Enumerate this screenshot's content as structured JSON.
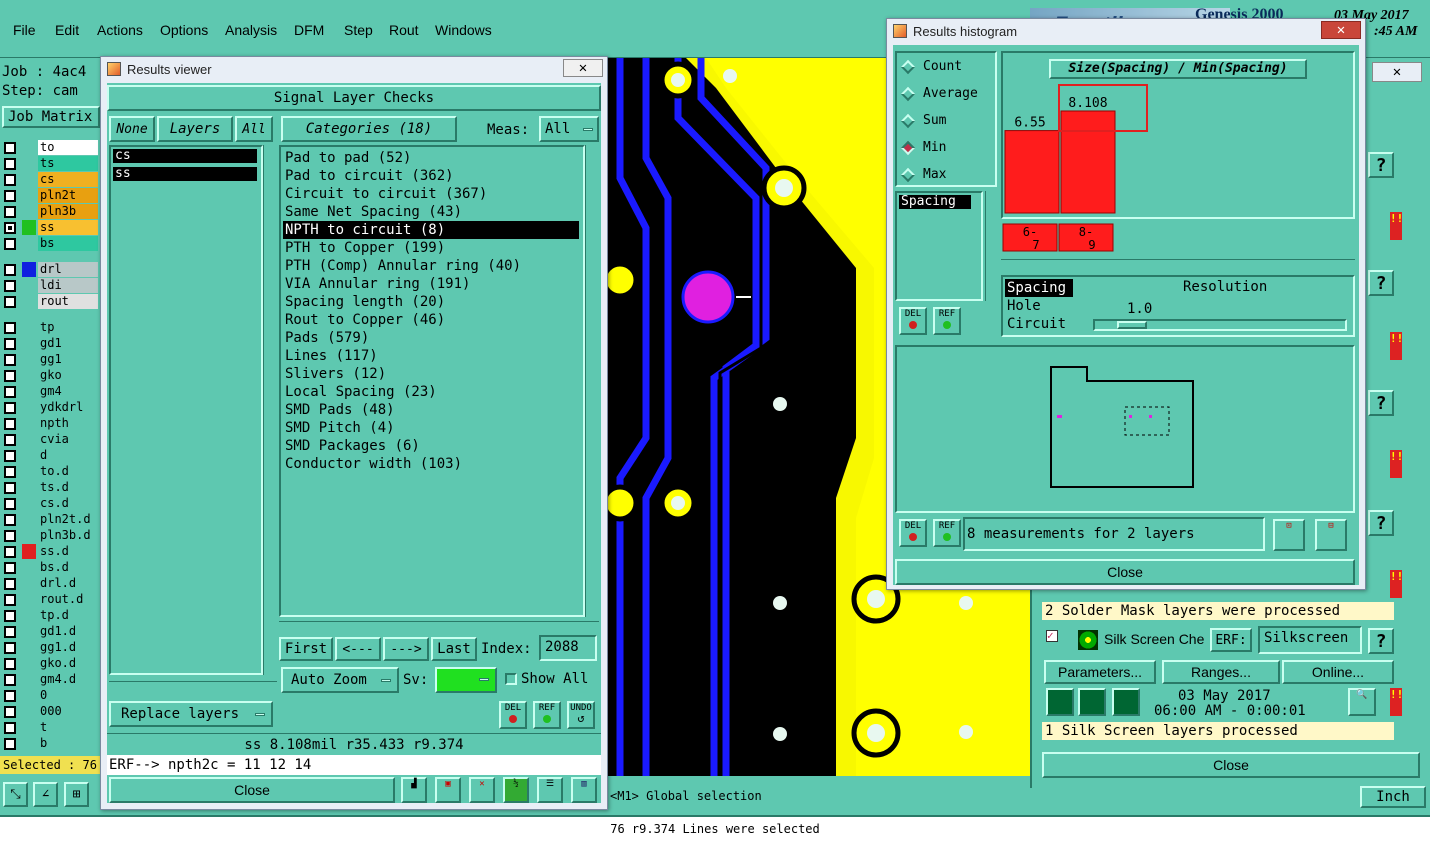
{
  "menubar": {
    "items": [
      "File",
      "Edit",
      "Actions",
      "Options",
      "Analysis",
      "DFM",
      "Step",
      "Rout",
      "Windows"
    ],
    "job_label": "Job : 4ac4",
    "step_label": "Step: cam",
    "job_matrix": "Job Matrix",
    "banner_date": "03 May 2017",
    "banner_time": ":45 AM",
    "banner_logo": "Frontline",
    "banner_app": "Genesis 2000"
  },
  "layers": [
    {
      "name": "to",
      "color": "#ffffff",
      "checked": false
    },
    {
      "name": "ts",
      "color": "#2ec8a0",
      "checked": false
    },
    {
      "name": "cs",
      "color": "#f0b020",
      "checked": false
    },
    {
      "name": "pln2t",
      "color": "#e8a010",
      "checked": false
    },
    {
      "name": "pln3b",
      "color": "#e8a010",
      "checked": false
    },
    {
      "name": "ss",
      "color": "#f8c030",
      "checked": true,
      "active": true
    },
    {
      "name": "bs",
      "color": "#2ec8a0",
      "checked": false
    },
    {
      "name": "drl",
      "color": "#b8c8c8",
      "checked": false,
      "swatch": "#1020e0"
    },
    {
      "name": "ldi",
      "color": "#b8c8c8",
      "checked": false
    },
    {
      "name": "rout",
      "color": "#e0e0e0",
      "checked": false
    },
    {
      "name": "tp",
      "color": "#5ec8b0",
      "checked": false
    },
    {
      "name": "gd1",
      "color": "#5ec8b0",
      "checked": false
    },
    {
      "name": "gg1",
      "color": "#5ec8b0",
      "checked": false
    },
    {
      "name": "gko",
      "color": "#5ec8b0",
      "checked": false
    },
    {
      "name": "gm4",
      "color": "#5ec8b0",
      "checked": false
    },
    {
      "name": "ydkdrl",
      "color": "#5ec8b0",
      "checked": false
    },
    {
      "name": "npth",
      "color": "#5ec8b0",
      "checked": false
    },
    {
      "name": "cvia",
      "color": "#5ec8b0",
      "checked": false
    },
    {
      "name": "d",
      "color": "#5ec8b0",
      "checked": false
    },
    {
      "name": "to.d",
      "color": "#5ec8b0",
      "checked": false
    },
    {
      "name": "ts.d",
      "color": "#5ec8b0",
      "checked": false
    },
    {
      "name": "cs.d",
      "color": "#5ec8b0",
      "checked": false
    },
    {
      "name": "pln2t.d",
      "color": "#5ec8b0",
      "checked": false
    },
    {
      "name": "pln3b.d",
      "color": "#5ec8b0",
      "checked": false
    },
    {
      "name": "ss.d",
      "color": "#5ec8b0",
      "checked": false,
      "swatch": "#e02020"
    },
    {
      "name": "bs.d",
      "color": "#5ec8b0",
      "checked": false
    },
    {
      "name": "drl.d",
      "color": "#5ec8b0",
      "checked": false
    },
    {
      "name": "rout.d",
      "color": "#5ec8b0",
      "checked": false
    },
    {
      "name": "tp.d",
      "color": "#5ec8b0",
      "checked": false
    },
    {
      "name": "gd1.d",
      "color": "#5ec8b0",
      "checked": false
    },
    {
      "name": "gg1.d",
      "color": "#5ec8b0",
      "checked": false
    },
    {
      "name": "gko.d",
      "color": "#5ec8b0",
      "checked": false
    },
    {
      "name": "gm4.d",
      "color": "#5ec8b0",
      "checked": false
    },
    {
      "name": "0",
      "color": "#5ec8b0",
      "checked": false
    },
    {
      "name": "000",
      "color": "#5ec8b0",
      "checked": false
    },
    {
      "name": "t",
      "color": "#5ec8b0",
      "checked": false
    },
    {
      "name": "b",
      "color": "#5ec8b0",
      "checked": false
    }
  ],
  "selected_label": "Selected : 76",
  "results_viewer": {
    "title": "Results viewer",
    "close_x": "✕",
    "section_title": "Signal Layer Checks",
    "btn_none": "None",
    "btn_layers": "Layers",
    "btn_all": "All",
    "categories_btn": "Categories (18)",
    "meas_label": "Meas:",
    "meas_value": "All",
    "layer_list": [
      "cs",
      "ss"
    ],
    "categories": [
      "Pad to pad (52)",
      "Pad to circuit (362)",
      "Circuit to circuit (367)",
      "Same Net Spacing (43)",
      "NPTH to circuit (8)",
      "PTH to Copper (199)",
      "PTH (Comp) Annular ring (40)",
      "VIA Annular ring (191)",
      "Spacing length (20)",
      "Rout to Copper (46)",
      "Pads (579)",
      "Lines (117)",
      "Slivers (12)",
      "Local Spacing (23)",
      "SMD Pads (48)",
      "SMD Pitch (4)",
      "SMD Packages (6)",
      "Conductor width (103)"
    ],
    "selected_category_index": 4,
    "nav_first": "First",
    "nav_prev": "<---",
    "nav_next": "--->",
    "nav_last": "Last",
    "index_label": "Index:",
    "index_value": "2088",
    "auto_zoom": "Auto Zoom",
    "sv_label": "Sv:",
    "show_all": "Show All",
    "replace_layers": "Replace layers",
    "btn_del": "DEL",
    "btn_ref": "REF",
    "btn_undo": "UNDO",
    "status_measure": "ss 8.108mil  r35.433  r9.374",
    "erf_line": "ERF--> npth2c = 11 12 14",
    "close": "Close"
  },
  "histogram": {
    "title": "Results histogram",
    "close_x": "✕",
    "radios": [
      {
        "label": "Count",
        "on": false
      },
      {
        "label": "Average",
        "on": false
      },
      {
        "label": "Sum",
        "on": false
      },
      {
        "label": "Min",
        "on": true
      },
      {
        "label": "Max",
        "on": false
      }
    ],
    "spacing_item": "Spacing",
    "chart_title": "Size(Spacing) / Min(Spacing)",
    "measurement_types": [
      "Spacing",
      "Hole",
      "Circuit"
    ],
    "resolution_label": "Resolution",
    "resolution_value": "1.0",
    "measurements_text": "8 measurements for 2 layers",
    "btn_del": "DEL",
    "btn_ref": "REF",
    "close": "Close"
  },
  "chart_data": {
    "type": "bar",
    "title": "Size(Spacing) / Min(Spacing)",
    "categories": [
      "6-7",
      "8-9"
    ],
    "values": [
      6.55,
      8.108
    ],
    "value_labels": [
      "6.55",
      "8.108"
    ],
    "highlighted_index": 1,
    "bar_color": "#ff1c1c"
  },
  "right_panel": {
    "solder_mask_text": "2 Solder Mask layers were processed",
    "silk_label": "Silk Screen Che",
    "erf_label": "ERF:",
    "erf_value": "Silkscreen",
    "parameters": "Parameters...",
    "ranges": "Ranges...",
    "online": "Online...",
    "date": "03 May 2017",
    "time": "06:00 AM - 0:00:01",
    "silk_processed": "1 Silk Screen layers processed",
    "close": "Close",
    "q": "?",
    "excl": "!!"
  },
  "bottom": {
    "global_selection": "<M1> Global selection",
    "units": "Inch",
    "status": "76 r9.374 Lines were selected"
  }
}
